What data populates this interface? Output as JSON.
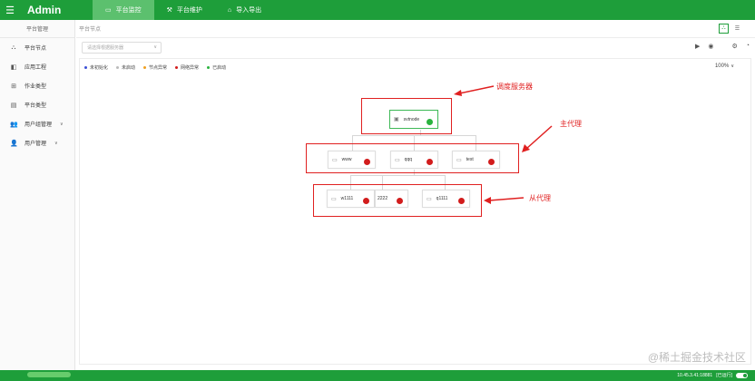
{
  "app": {
    "brand": "Admin"
  },
  "topbar": {
    "tabs": [
      {
        "label": "平台监控",
        "icon": "monitor-icon",
        "active": true
      },
      {
        "label": "平台维护",
        "icon": "wrench-icon",
        "active": false
      },
      {
        "label": "导入导出",
        "icon": "home-icon",
        "active": false
      }
    ]
  },
  "sidebar": {
    "header": "平台管理",
    "items": [
      {
        "label": "平台节点",
        "icon": "topology-icon",
        "chevron": ""
      },
      {
        "label": "应用工程",
        "icon": "cube-icon",
        "chevron": ""
      },
      {
        "label": "作业类型",
        "icon": "grid-icon",
        "chevron": ""
      },
      {
        "label": "平台类型",
        "icon": "list-icon",
        "chevron": ""
      },
      {
        "label": "用户组管理",
        "icon": "users-icon",
        "chevron": "∨"
      },
      {
        "label": "用户管理",
        "icon": "user-icon",
        "chevron": "∨"
      }
    ]
  },
  "main": {
    "breadcrumb": "平台节点",
    "search": {
      "placeholder": "请选择根据服务器"
    },
    "zoom": "100%",
    "legend": [
      {
        "label": "未初始化",
        "color": "#3b4fd6"
      },
      {
        "label": "未启动",
        "color": "#bbbbbb"
      },
      {
        "label": "节点异常",
        "color": "#f0a020"
      },
      {
        "label": "网络异常",
        "color": "#d21c1c"
      },
      {
        "label": "已启动",
        "color": "#2bb33f"
      }
    ],
    "nodes": {
      "root": {
        "label": "svtnode",
        "status": "#2bb33f"
      },
      "primary": [
        {
          "label": "www",
          "status": "#d21c1c"
        },
        {
          "label": "qqq",
          "status": "#d21c1c"
        },
        {
          "label": "test",
          "status": "#d21c1c"
        }
      ],
      "secondary": [
        {
          "label": "w1111",
          "status": "#d21c1c"
        },
        {
          "label": "2222",
          "status": "#d21c1c"
        },
        {
          "label": "q1111",
          "status": "#d21c1c"
        }
      ]
    },
    "annotations": {
      "scheduler": "调度服务器",
      "primary": "主代理",
      "secondary": "从代理"
    }
  },
  "footer": {
    "version": "10.45.3.41:18881",
    "status": "[已运行]"
  },
  "watermark": "@稀土掘金技术社区",
  "colors": {
    "brand": "#1e9e3a",
    "annotation": "#e02020"
  }
}
